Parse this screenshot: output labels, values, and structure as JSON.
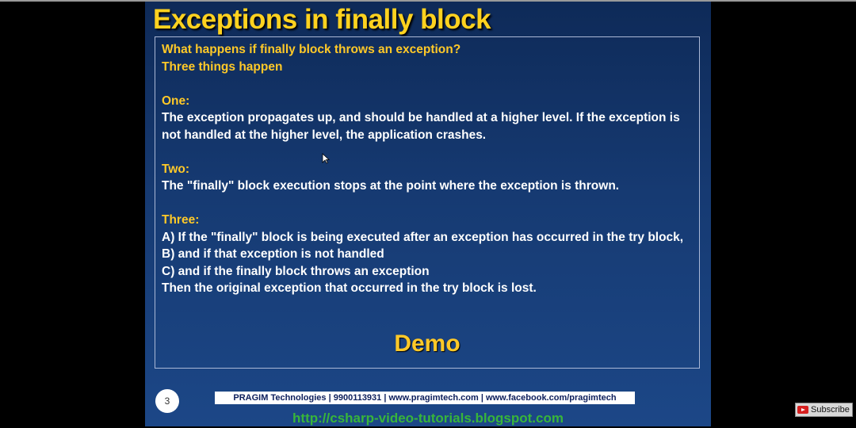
{
  "slide": {
    "title": "Exceptions in finally block",
    "question": "What happens if finally block throws an exception?",
    "intro": "Three things happen",
    "one_heading": "One:",
    "one_text": "The exception propagates up, and should be handled at a higher level. If the exception is not handled at the higher level, the application crashes.",
    "two_heading": "Two:",
    "two_text": "The \"finally\" block execution stops at the point where the exception is thrown.",
    "three_heading": "Three:",
    "three_a": "A) If the \"finally\" block is being executed after an exception has occurred in the try block,",
    "three_b": "B) and if that exception is not handled",
    "three_c": "C) and if the finally block throws an exception",
    "three_conclusion": "Then the original exception that occurred in the try block is lost.",
    "demo": "Demo",
    "page_number": "3",
    "footer": "PRAGIM Technologies | 9900113931 | www.pragimtech.com | www.facebook.com/pragimtech",
    "url": "http://csharp-video-tutorials.blogspot.com"
  },
  "overlay": {
    "subscribe_label": "Subscribe",
    "subscribe_icon": "youtube-icon",
    "cursor_icon": "mouse-pointer-icon"
  },
  "colors": {
    "heading": "#ffc928",
    "background": "#163a72",
    "url": "#38b53a"
  }
}
